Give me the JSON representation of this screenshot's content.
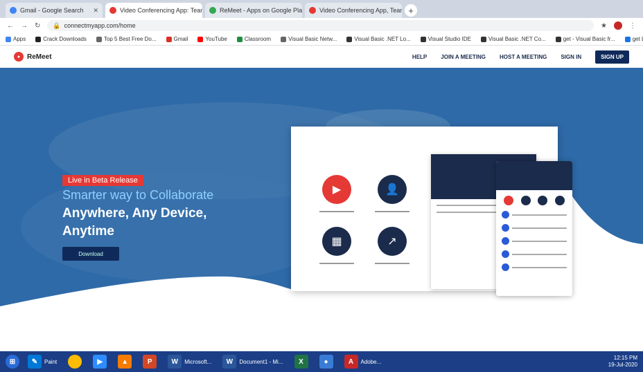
{
  "browser": {
    "tabs": [
      {
        "label": "Gmail - Google Search",
        "favicon_color": "#4285f4",
        "active": false
      },
      {
        "label": "Video Conferencing App: Team",
        "favicon_color": "#e53935",
        "active": true
      },
      {
        "label": "ReMeet - Apps on Google Play",
        "favicon_color": "#34a853",
        "active": false
      },
      {
        "label": "Video Conferencing App, Team",
        "favicon_color": "#e53935",
        "active": false
      }
    ],
    "url": "connectmyapp.com/home",
    "bookmarks": [
      "Apps",
      "Crack Downloads",
      "Top 5 Best Free Do...",
      "Gmail",
      "YouTube",
      "Classroom",
      "Visual Basic Netw...",
      "Visual Basic .NET Lo...",
      "Visual Studio IDE",
      "Visual Basic .NET Co...",
      "get - Visual Basic fr...",
      "get Lecture Links"
    ]
  },
  "site": {
    "logo_text": "ReMeet",
    "nav": [
      "HELP",
      "JOIN A MEETING",
      "HOST A MEETING",
      "SIGN IN"
    ],
    "signup_label": "SIGN UP"
  },
  "hero": {
    "badge": "Live in Beta Release",
    "line1": "Smarter way to Collaborate",
    "line2": "Anywhere, Any Device,",
    "line3": "Anytime",
    "download_label": "Download"
  },
  "taskbar": {
    "items": [
      "",
      "Paint",
      "",
      "",
      "",
      "",
      "Microsoft...",
      "Document1 - Mi...",
      "",
      "",
      "Adobe..."
    ],
    "clock_time": "12:15 PM",
    "clock_date": "19-Jul-2020"
  },
  "colors": {
    "accent_red": "#e53935",
    "navy": "#0f2a5a",
    "hero_blue": "#2e6aa8"
  }
}
